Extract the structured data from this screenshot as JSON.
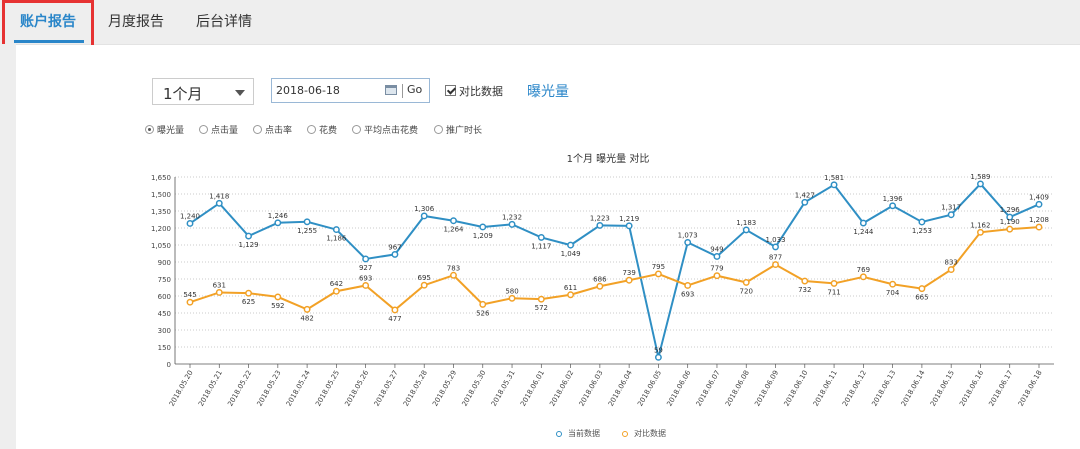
{
  "tabs": [
    {
      "label": "账户报告",
      "active": true
    },
    {
      "label": "月度报告",
      "active": false
    },
    {
      "label": "后台详情",
      "active": false
    }
  ],
  "filters": {
    "period": "1个月",
    "date": "2018-06-18",
    "go_label": "Go",
    "compare_label": "对比数据",
    "compare_checked": true,
    "metric_link": "曝光量"
  },
  "metrics": [
    {
      "label": "曝光量",
      "selected": true
    },
    {
      "label": "点击量",
      "selected": false
    },
    {
      "label": "点击率",
      "selected": false
    },
    {
      "label": "花费",
      "selected": false
    },
    {
      "label": "平均点击花费",
      "selected": false
    },
    {
      "label": "推广时长",
      "selected": false
    }
  ],
  "colors": {
    "accent": "#2a86c9",
    "current": "#2f8fc4",
    "compare": "#f2a126",
    "highlight": "#e63232"
  },
  "chart_data": {
    "type": "line",
    "title": "1个月  曝光量  对比",
    "y_ticks": [
      "0",
      "150",
      "300",
      "450",
      "600",
      "750",
      "900",
      "1,050",
      "1,200",
      "1,350",
      "1,500",
      "1,650"
    ],
    "ylim": [
      0,
      1650
    ],
    "grid": true,
    "legend_position": "bottom",
    "categories": [
      "2018.05.20",
      "2018.05.21",
      "2018.05.22",
      "2018.05.23",
      "2018.05.24",
      "2018.05.25",
      "2018.05.26",
      "2018.05.27",
      "2018.05.28",
      "2018.05.29",
      "2018.05.30",
      "2018.05.31",
      "2018.06.01",
      "2018.06.02",
      "2018.06.03",
      "2018.06.04",
      "2018.06.05",
      "2018.06.06",
      "2018.06.07",
      "2018.06.08",
      "2018.06.09",
      "2018.06.10",
      "2018.06.11",
      "2018.06.12",
      "2018.06.13",
      "2018.06.14",
      "2018.06.15",
      "2018.06.16",
      "2018.06.17",
      "2018.06.18"
    ],
    "series": [
      {
        "name": "当前数据",
        "color": "#2f8fc4",
        "values": [
          1240,
          1418,
          1129,
          1246,
          1255,
          1186,
          927,
          967,
          1306,
          1264,
          1209,
          1232,
          1117,
          1049,
          1223,
          1219,
          59,
          1073,
          949,
          1183,
          1033,
          1427,
          1581,
          1244,
          1396,
          1253,
          1317,
          1589,
          1296,
          1409
        ],
        "labels": [
          "1,240",
          "1,418",
          "1,129",
          "1,246",
          "1,255",
          "1,186",
          "927",
          "967",
          "1,306",
          "1,264",
          "1,209",
          "1,232",
          "1,117",
          "1,049",
          "1,223",
          "1,219",
          "59",
          "1,073",
          "949",
          "1,183",
          "1,033",
          "1,427",
          "1,581",
          "1,244",
          "1,396",
          "1,253",
          "1,317",
          "1,589",
          "1,296",
          "1,409"
        ]
      },
      {
        "name": "对比数据",
        "color": "#f2a126",
        "values": [
          545,
          631,
          625,
          592,
          482,
          642,
          693,
          477,
          695,
          783,
          526,
          580,
          572,
          611,
          686,
          739,
          795,
          693,
          779,
          720,
          877,
          732,
          711,
          769,
          704,
          665,
          833,
          1162,
          1190,
          1208
        ],
        "labels": [
          "545",
          "631",
          "625",
          "592",
          "482",
          "642",
          "693",
          "477",
          "695",
          "783",
          "526",
          "580",
          "572",
          "611",
          "686",
          "739",
          "795",
          "693",
          "779",
          "720",
          "877",
          "732",
          "711",
          "769",
          "704",
          "665",
          "833",
          "1,162",
          "1,190",
          "1,208"
        ]
      }
    ]
  }
}
